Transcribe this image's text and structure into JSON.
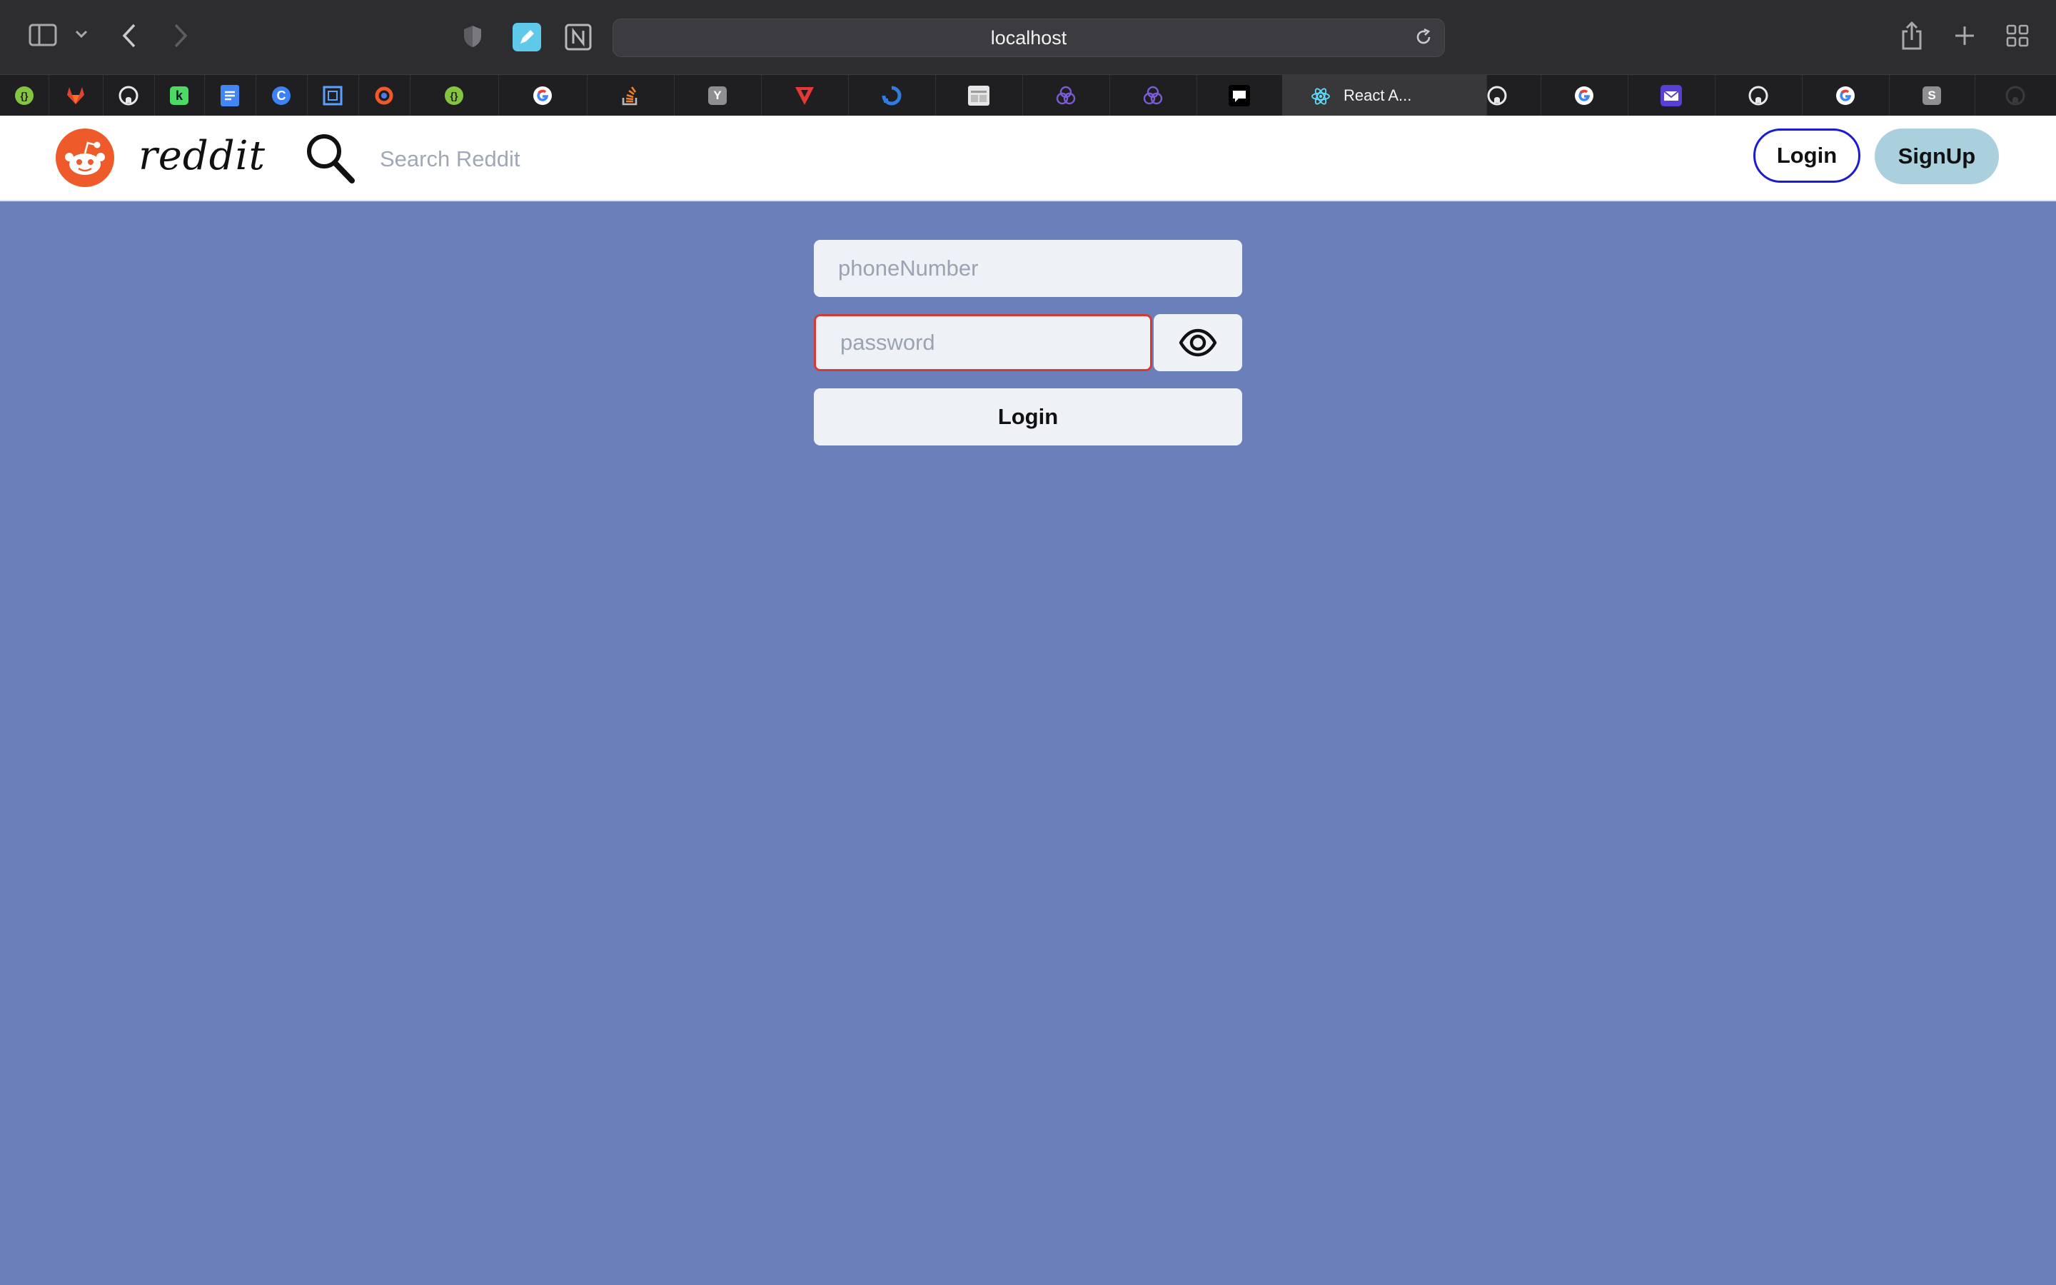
{
  "browser": {
    "url": "localhost",
    "active_tab_label": "React A...",
    "tabs": [
      {
        "icon": "green-braces-icon"
      },
      {
        "icon": "gitlab-icon"
      },
      {
        "icon": "github-icon"
      },
      {
        "icon": "green-k-icon"
      },
      {
        "icon": "google-docs-icon"
      },
      {
        "icon": "blue-c-icon"
      },
      {
        "icon": "frame-icon"
      },
      {
        "icon": "orange-ring-icon"
      },
      {
        "icon": "green-braces-icon"
      },
      {
        "icon": "google-icon"
      },
      {
        "icon": "stackoverflow-icon"
      },
      {
        "icon": "y-icon",
        "glyph": "Y"
      },
      {
        "icon": "red-v-icon"
      },
      {
        "icon": "blue-spinner-icon"
      },
      {
        "icon": "window-icon"
      },
      {
        "icon": "purple-knot-icon"
      },
      {
        "icon": "purple-knot-icon"
      },
      {
        "icon": "chat-icon"
      },
      {
        "icon": "react-icon"
      },
      {
        "icon": "github-icon"
      },
      {
        "icon": "google-icon"
      },
      {
        "icon": "mail-icon"
      },
      {
        "icon": "github-icon"
      },
      {
        "icon": "google-icon"
      },
      {
        "icon": "s-icon",
        "glyph": "S"
      },
      {
        "icon": "github-icon"
      }
    ]
  },
  "header": {
    "logo_text": "reddit",
    "search_placeholder": "Search Reddit",
    "login_label": "Login",
    "signup_label": "SignUp"
  },
  "form": {
    "phone_placeholder": "phoneNumber",
    "password_placeholder": "password",
    "submit_label": "Login",
    "password_error": true
  },
  "colors": {
    "page_background": "#6b80ba",
    "reddit_orange": "#ef5a2b",
    "login_border": "#1b1bd6",
    "signup_background": "#aacfdd",
    "error_border": "#d33b34"
  }
}
